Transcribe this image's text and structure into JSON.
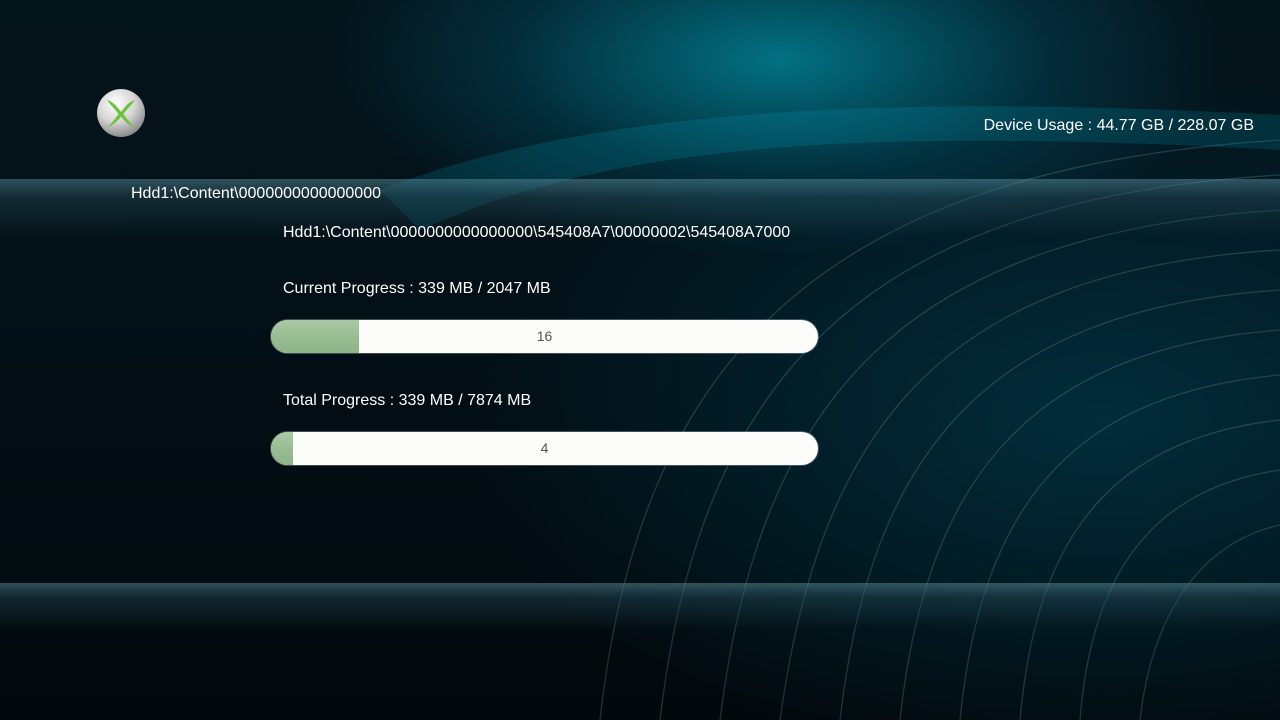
{
  "header": {
    "logo_icon": "xbox-logo-icon",
    "device_usage": "Device Usage : 44.77 GB / 228.07 GB"
  },
  "breadcrumb": "Hdd1:\\Content\\0000000000000000",
  "transfer": {
    "file_path": "Hdd1:\\Content\\0000000000000000\\545408A7\\00000002\\545408A7000",
    "current": {
      "label": "Current Progress : 339 MB / 2047 MB",
      "percent": 16,
      "percent_text": "16"
    },
    "total": {
      "label": "Total Progress : 339 MB / 7874 MB",
      "percent": 4,
      "percent_text": "4"
    }
  },
  "colors": {
    "accent": "#00b4d0",
    "progress_fill": "#9cc096",
    "progress_track": "#fbfbf9"
  }
}
